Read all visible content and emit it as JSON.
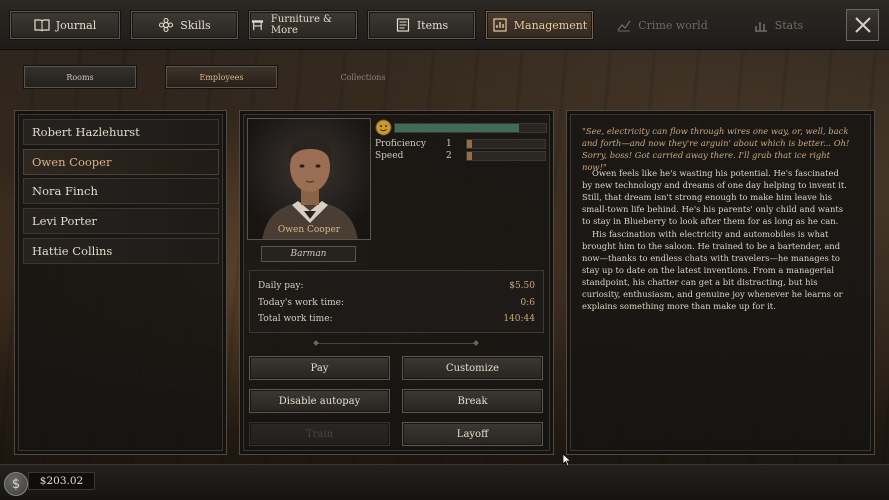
{
  "nav": {
    "tabs": [
      {
        "label": "Journal",
        "icon": "book-icon",
        "state": "normal"
      },
      {
        "label": "Skills",
        "icon": "gear-flower-icon",
        "state": "normal"
      },
      {
        "label": "Furniture & More",
        "icon": "table-icon",
        "state": "normal"
      },
      {
        "label": "Items",
        "icon": "list-icon",
        "state": "normal"
      },
      {
        "label": "Management",
        "icon": "ledger-icon",
        "state": "active"
      },
      {
        "label": "Crime world",
        "icon": "chart-icon",
        "state": "disabled"
      },
      {
        "label": "Stats",
        "icon": "bars-icon",
        "state": "disabled"
      }
    ],
    "close_icon": "close-icon"
  },
  "subtabs": {
    "rooms": "Rooms",
    "employees": "Employees",
    "collections": "Collections"
  },
  "employees": [
    {
      "name": "Robert Hazlehurst"
    },
    {
      "name": "Owen Cooper"
    },
    {
      "name": "Nora Finch"
    },
    {
      "name": "Levi Porter"
    },
    {
      "name": "Hattie Collins"
    }
  ],
  "selected": {
    "name": "Owen Cooper",
    "role": "Barman",
    "mood_icon": "smiley-icon",
    "mood_level": 0.82,
    "stats": [
      {
        "label": "Proficiency",
        "value": "1",
        "level": 0.07
      },
      {
        "label": "Speed",
        "value": "2",
        "level": 0.07
      }
    ],
    "info": {
      "daily_pay_label": "Daily pay:",
      "daily_pay": "$5.50",
      "today_label": "Today's work time:",
      "today": "0:6",
      "total_label": "Total work time:",
      "total": "140:44"
    }
  },
  "actions": {
    "pay": "Pay",
    "customize": "Customize",
    "disable_autopay": "Disable autopay",
    "break": "Break",
    "train": "Train",
    "layoff": "Layoff"
  },
  "bio": {
    "quote": "\"See, electricity can flow through wires one way, or, well, back and forth—and now they're arguin' about which is better... Oh! Sorry, boss! Got carried away there. I'll grab that ice right now!\"",
    "p1": "Owen feels like he's wasting his potential. He's fascinated by new technology and dreams of one day helping to invent it. Still, that dream isn't strong enough to make him leave his small-town life behind. He's his parents' only child and wants to stay in Blueberry to look after them for as long as he can.",
    "p2": "His fascination with electricity and automobiles is what brought him to the saloon. He trained to be a bartender, and now—thanks to endless chats with travelers—he manages to stay up to date on the latest inventions. From a managerial standpoint, his chatter can get a bit distracting, but his curiosity, enthusiasm, and genuine joy whenever he learns or explains something more than make up for it."
  },
  "wallet": {
    "currency_symbol": "$",
    "amount": "$203.02"
  },
  "colors": {
    "accent": "#d8b88c",
    "mood_bar": "#3f6b57",
    "stat_fill": "#9a6c3e"
  }
}
